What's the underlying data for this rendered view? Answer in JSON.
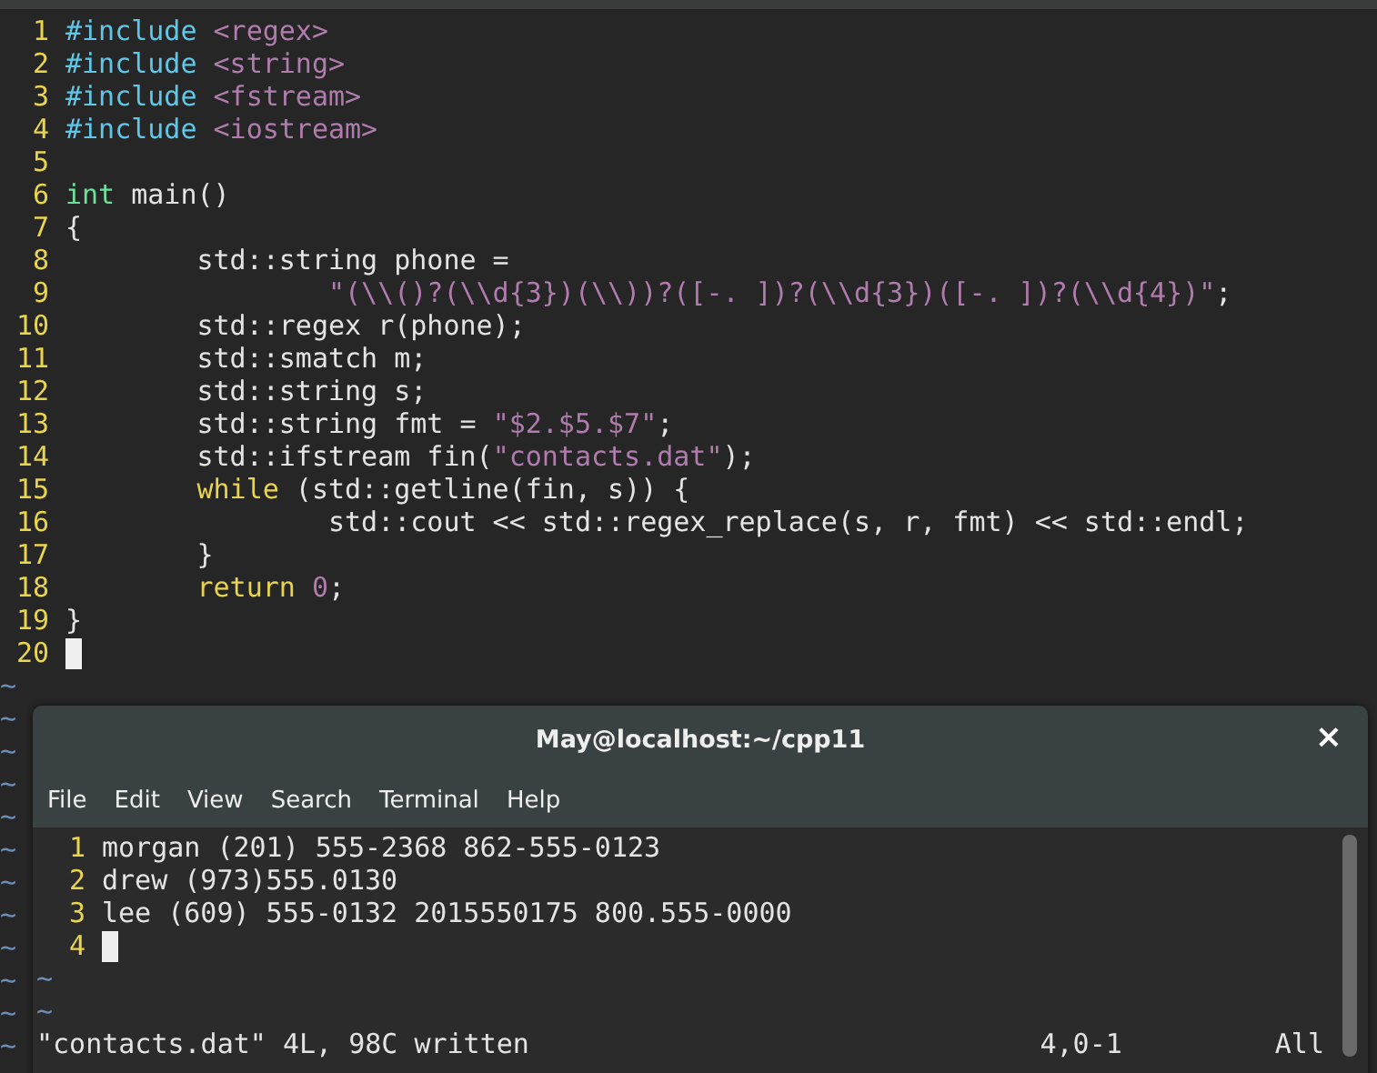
{
  "editor": {
    "lines": [
      {
        "number": "1",
        "cursor": false,
        "tokens": [
          {
            "kind": "preproc",
            "text": "#include "
          },
          {
            "kind": "string",
            "text": "<regex>"
          }
        ]
      },
      {
        "number": "2",
        "cursor": false,
        "tokens": [
          {
            "kind": "preproc",
            "text": "#include "
          },
          {
            "kind": "string",
            "text": "<string>"
          }
        ]
      },
      {
        "number": "3",
        "cursor": false,
        "tokens": [
          {
            "kind": "preproc",
            "text": "#include "
          },
          {
            "kind": "string",
            "text": "<fstream>"
          }
        ]
      },
      {
        "number": "4",
        "cursor": false,
        "tokens": [
          {
            "kind": "preproc",
            "text": "#include "
          },
          {
            "kind": "string",
            "text": "<iostream>"
          }
        ]
      },
      {
        "number": "5",
        "cursor": false
      },
      {
        "number": "6",
        "cursor": false,
        "tokens": [
          {
            "kind": "type",
            "text": "int"
          },
          {
            "kind": "plain",
            "text": " main()"
          }
        ]
      },
      {
        "number": "7",
        "cursor": false,
        "tokens": [
          {
            "kind": "plain",
            "text": "{"
          }
        ]
      },
      {
        "number": "8",
        "cursor": false,
        "tokens": [
          {
            "kind": "plain",
            "text": "        std::string phone ="
          }
        ]
      },
      {
        "number": "9",
        "cursor": false,
        "tokens": [
          {
            "kind": "string",
            "text": "                \"(\\\\()?(\\\\d{3})(\\\\))?([-. ])?(\\\\d{3})([-. ])?(\\\\d{4})\""
          },
          {
            "kind": "plain",
            "text": ";"
          }
        ]
      },
      {
        "number": "10",
        "cursor": false,
        "tokens": [
          {
            "kind": "plain",
            "text": "        std::regex r(phone);"
          }
        ]
      },
      {
        "number": "11",
        "cursor": false,
        "tokens": [
          {
            "kind": "plain",
            "text": "        std::smatch m;"
          }
        ]
      },
      {
        "number": "12",
        "cursor": false,
        "tokens": [
          {
            "kind": "plain",
            "text": "        std::string s;"
          }
        ]
      },
      {
        "number": "13",
        "cursor": false,
        "tokens": [
          {
            "kind": "plain",
            "text": "        std::string fmt = "
          },
          {
            "kind": "string",
            "text": "\"$2.$5.$7\""
          },
          {
            "kind": "plain",
            "text": ";"
          }
        ]
      },
      {
        "number": "14",
        "cursor": false,
        "tokens": [
          {
            "kind": "plain",
            "text": "        std::ifstream fin("
          },
          {
            "kind": "string",
            "text": "\"contacts.dat\""
          },
          {
            "kind": "plain",
            "text": ");"
          }
        ]
      },
      {
        "number": "15",
        "cursor": false,
        "tokens": [
          {
            "kind": "keyword",
            "text": "        while"
          },
          {
            "kind": "plain",
            "text": " (std::getline(fin, s)) {"
          }
        ]
      },
      {
        "number": "16",
        "cursor": false,
        "tokens": [
          {
            "kind": "plain",
            "text": "                std::cout << std::regex_replace(s, r, fmt) << std::endl;"
          }
        ]
      },
      {
        "number": "17",
        "cursor": false,
        "tokens": [
          {
            "kind": "plain",
            "text": "        }"
          }
        ]
      },
      {
        "number": "18",
        "cursor": false,
        "tokens": [
          {
            "kind": "keyword",
            "text": "        return "
          },
          {
            "kind": "number",
            "text": "0"
          },
          {
            "kind": "plain",
            "text": ";"
          }
        ]
      },
      {
        "number": "19",
        "cursor": false,
        "tokens": [
          {
            "kind": "plain",
            "text": "}"
          }
        ]
      },
      {
        "number": "20",
        "cursor": true
      }
    ],
    "empty_markers": [
      "~",
      "~",
      "~",
      "~",
      "~",
      "~",
      "~",
      "~",
      "~",
      "~",
      "~",
      "~"
    ]
  },
  "terminal": {
    "title": "May@localhost:~/cpp11",
    "close": "×",
    "menu": [
      "File",
      "Edit",
      "View",
      "Search",
      "Terminal",
      "Help"
    ],
    "lines": [
      {
        "number": "1",
        "text": "morgan (201) 555-2368 862-555-0123",
        "cursor": false
      },
      {
        "number": "2",
        "text": "drew (973)555.0130",
        "cursor": false
      },
      {
        "number": "3",
        "text": "lee (609) 555-0132 2015550175 800.555-0000",
        "cursor": false
      },
      {
        "number": "4",
        "cursor": true
      }
    ],
    "empty_markers": [
      "~",
      "~"
    ],
    "status": {
      "message": "\"contacts.dat\" 4L, 98C written",
      "position": "4,0-1",
      "scroll": "All"
    }
  }
}
